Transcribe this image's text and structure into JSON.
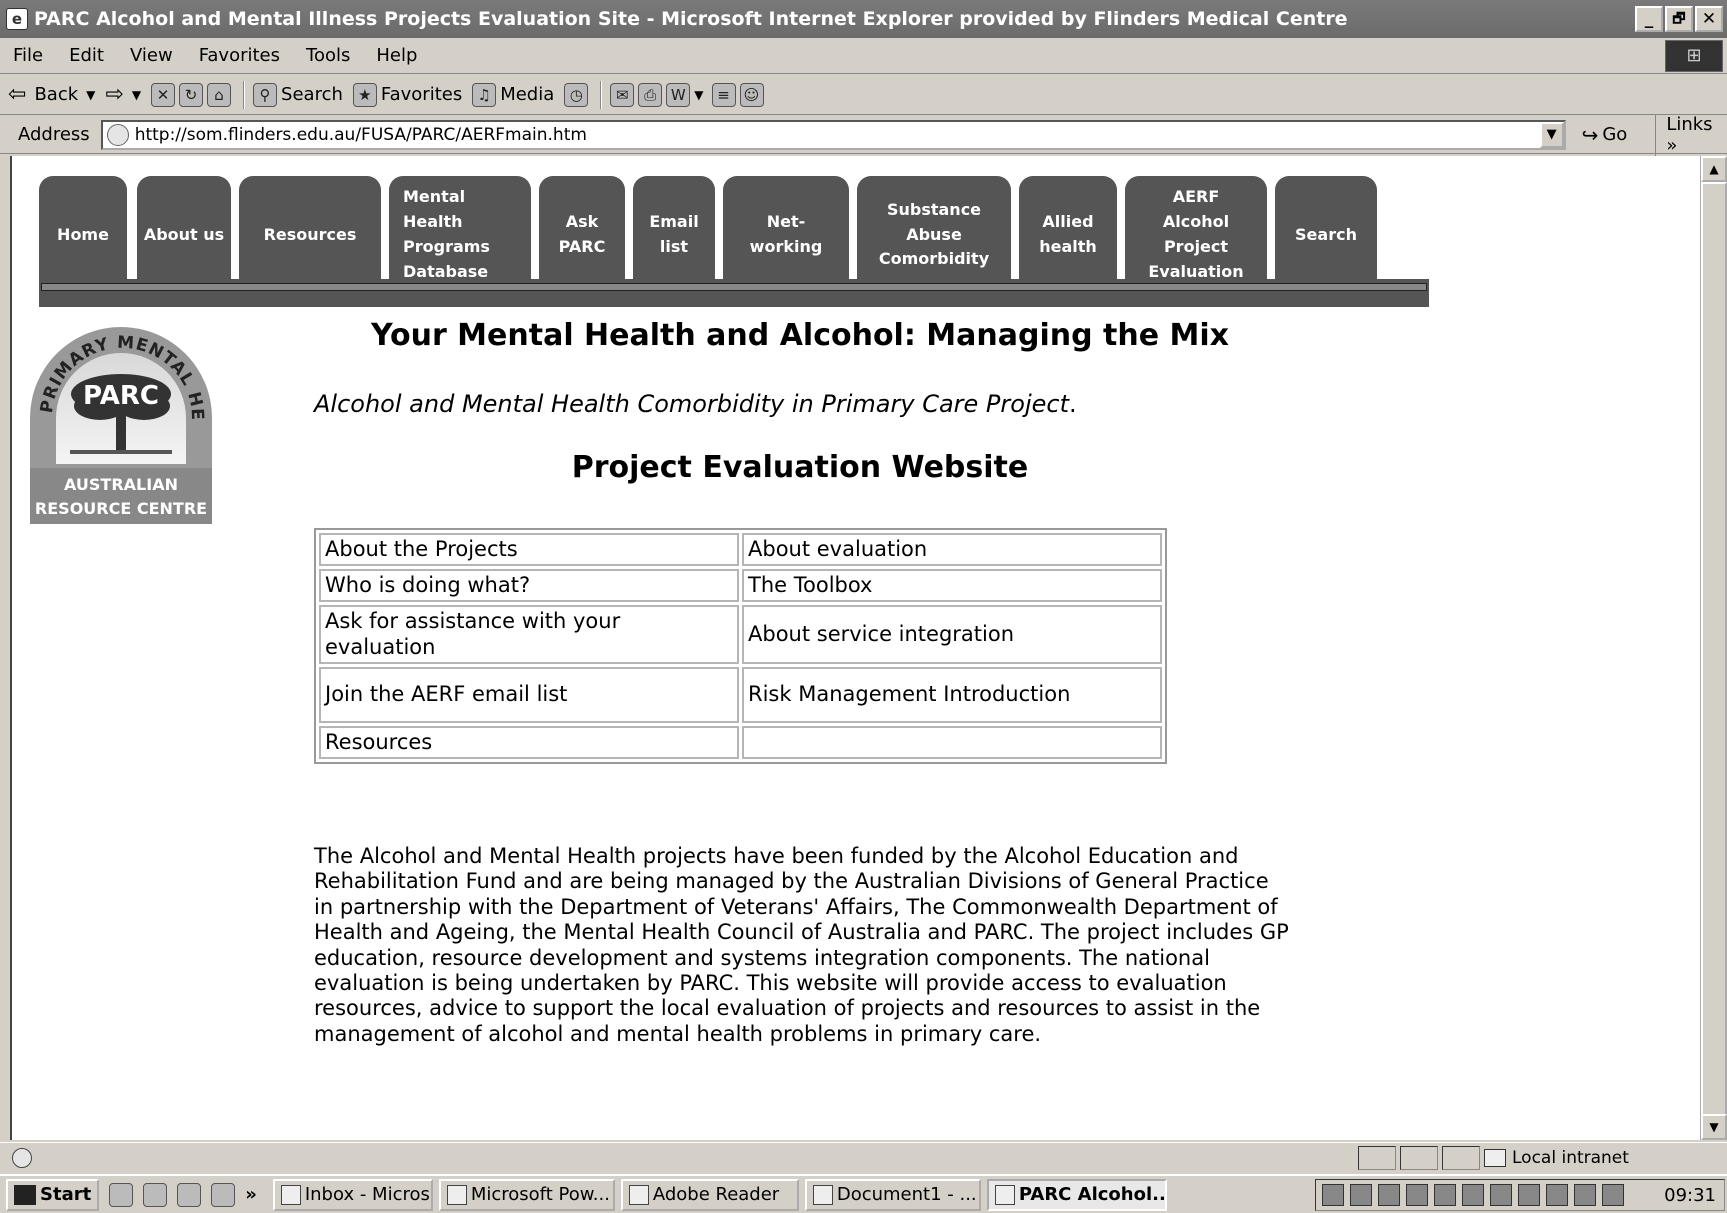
{
  "window": {
    "title": "PARC Alcohol and Mental Illness Projects Evaluation Site - Microsoft Internet Explorer provided by Flinders Medical Centre",
    "buttons": [
      "_",
      "̅□",
      "X"
    ]
  },
  "menu": [
    "File",
    "Edit",
    "View",
    "Favorites",
    "Tools",
    "Help"
  ],
  "toolbar": {
    "back": "Back",
    "search": "Search",
    "favorites": "Favorites",
    "media": "Media"
  },
  "address": {
    "label": "Address",
    "url": "http://som.flinders.edu.au/FUSA/PARC/AERFmain.htm",
    "go": "Go",
    "links": "Links"
  },
  "nav_tabs": [
    {
      "label": "Home"
    },
    {
      "label": "About us"
    },
    {
      "label": "Resources"
    },
    {
      "label": "Mental Health Programs Database"
    },
    {
      "label": "Ask PARC"
    },
    {
      "label": "Email list"
    },
    {
      "label": "Net- working"
    },
    {
      "label": "Substance Abuse Comorbidity"
    },
    {
      "label": "Allied health"
    },
    {
      "label": "AERF Alcohol Project Evaluation"
    },
    {
      "label": "Search"
    }
  ],
  "logo": {
    "arc_text": "PRIMARY MENTAL HEALTH CARE",
    "center_text": "PARC",
    "bottom_text": "AUSTRALIAN RESOURCE CENTRE"
  },
  "page": {
    "heading": "Your Mental Health and Alcohol: Managing the Mix",
    "subheading": "Alcohol and Mental Health Comorbidity in Primary Care Project",
    "subheading_end": ".",
    "eval_heading": "Project Evaluation Website",
    "links": [
      [
        "About the Projects",
        "About evaluation"
      ],
      [
        "Who is doing what?",
        "The Toolbox"
      ],
      [
        "Ask for assistance with your evaluation",
        "About service integration"
      ],
      [
        "Join the AERF email list",
        "Risk Management Introduction"
      ],
      [
        "Resources",
        ""
      ]
    ],
    "paragraph": "The Alcohol and Mental Health projects have been funded by the Alcohol Education and Rehabilitation Fund and are being managed by the Australian Divisions of General Practice in partnership with the Department of Veterans' Affairs, The Commonwealth Department of Health and Ageing, the Mental Health Council of Australia and PARC. The project includes GP education, resource development and systems integration components. The national evaluation is being undertaken by PARC. This website will provide access to evaluation resources, advice to support the local evaluation of projects and resources to assist in the management of alcohol and mental health problems in primary care."
  },
  "status": {
    "zone": "Local intranet"
  },
  "taskbar": {
    "start": "Start",
    "chevron": "»",
    "tasks": [
      "Inbox - Micros...",
      "Microsoft Pow...",
      "Adobe Reader",
      "Document1 - ...",
      "PARC Alcohol..."
    ],
    "clock": "09:31"
  }
}
